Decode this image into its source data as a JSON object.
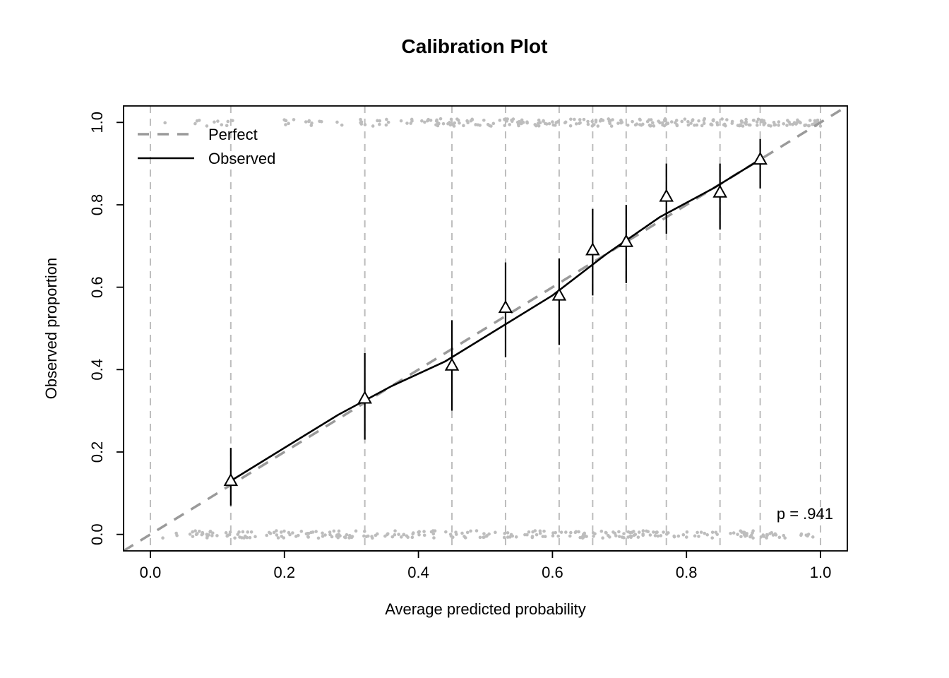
{
  "chart_data": {
    "type": "scatter",
    "title": "Calibration Plot",
    "xlabel": "Average predicted probability",
    "ylabel": "Observed proportion",
    "xlim": [
      -0.04,
      1.04
    ],
    "ylim": [
      -0.04,
      1.04
    ],
    "x_ticks": [
      0.0,
      0.2,
      0.4,
      0.6,
      0.8,
      1.0
    ],
    "y_ticks": [
      0.0,
      0.2,
      0.4,
      0.6,
      0.8,
      1.0
    ],
    "legend": {
      "entries": [
        "Perfect",
        "Observed"
      ],
      "position": "top-left"
    },
    "annotation": "p = .941",
    "grid_vlines": [
      0.0,
      0.12,
      0.32,
      0.45,
      0.53,
      0.61,
      0.66,
      0.71,
      0.77,
      0.85,
      0.91,
      1.0
    ],
    "perfect_line": {
      "x": [
        -0.04,
        1.04
      ],
      "y": [
        -0.04,
        1.04
      ]
    },
    "observed_curve": {
      "x": [
        0.12,
        0.2,
        0.28,
        0.36,
        0.44,
        0.52,
        0.6,
        0.68,
        0.76,
        0.84,
        0.91
      ],
      "y": [
        0.13,
        0.21,
        0.29,
        0.36,
        0.42,
        0.5,
        0.58,
        0.68,
        0.77,
        0.84,
        0.91
      ]
    },
    "points": [
      {
        "x": 0.12,
        "y": 0.13,
        "lo": 0.07,
        "hi": 0.21
      },
      {
        "x": 0.32,
        "y": 0.33,
        "lo": 0.23,
        "hi": 0.44
      },
      {
        "x": 0.45,
        "y": 0.41,
        "lo": 0.3,
        "hi": 0.52
      },
      {
        "x": 0.53,
        "y": 0.55,
        "lo": 0.43,
        "hi": 0.66
      },
      {
        "x": 0.61,
        "y": 0.58,
        "lo": 0.46,
        "hi": 0.67
      },
      {
        "x": 0.66,
        "y": 0.69,
        "lo": 0.58,
        "hi": 0.79
      },
      {
        "x": 0.71,
        "y": 0.71,
        "lo": 0.61,
        "hi": 0.8
      },
      {
        "x": 0.77,
        "y": 0.82,
        "lo": 0.73,
        "hi": 0.9
      },
      {
        "x": 0.85,
        "y": 0.83,
        "lo": 0.74,
        "hi": 0.9
      },
      {
        "x": 0.91,
        "y": 0.91,
        "lo": 0.84,
        "hi": 0.96
      }
    ],
    "rug_top_seed": 12345,
    "rug_bottom_seed": 67890
  }
}
